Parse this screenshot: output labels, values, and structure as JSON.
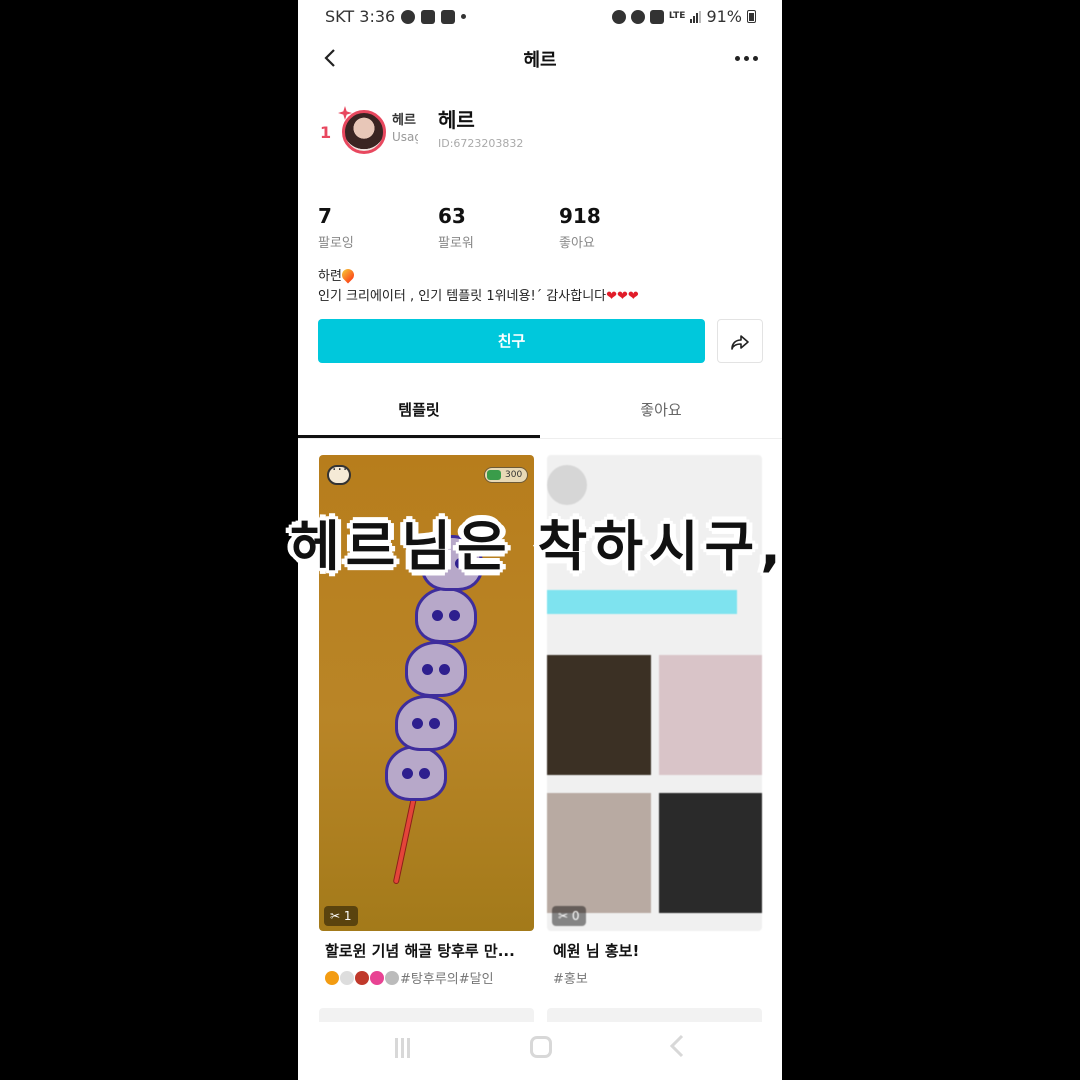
{
  "status_bar": {
    "carrier_time": "SKT 3:36",
    "network": "LTE",
    "battery": "91%"
  },
  "header": {
    "title": "헤르"
  },
  "profile": {
    "rank": "1",
    "mini_name": "헤르",
    "mini_sub": "Usage",
    "name": "헤르",
    "user_id": "ID:6723203832",
    "stats": [
      {
        "value": "7",
        "label": "팔로잉"
      },
      {
        "value": "63",
        "label": "팔로워"
      },
      {
        "value": "918",
        "label": "좋아요"
      }
    ],
    "bio_line1": "하련",
    "bio_line2": "인기 크리에이터 , 인기 템플릿 1위네용!ˊ 감사합니다",
    "bio_hearts": "❤❤❤",
    "friend_button": "친구"
  },
  "tabs": [
    {
      "label": "템플릿",
      "active": true
    },
    {
      "label": "좋아요",
      "active": false
    }
  ],
  "cards": [
    {
      "coin_value": "300",
      "cut_count": "1",
      "title": "할로윈 기념 해골 탕후루 만...",
      "tags": "#탕후루의#달인"
    },
    {
      "cut_count": "0",
      "title": "예원 님 홍보!",
      "tags": "#홍보"
    }
  ],
  "overlay_caption": "헤르님은 착하시구,",
  "colors": {
    "accent": "#00c8dc",
    "rank": "#e8485f",
    "heart": "#e11d2a"
  }
}
